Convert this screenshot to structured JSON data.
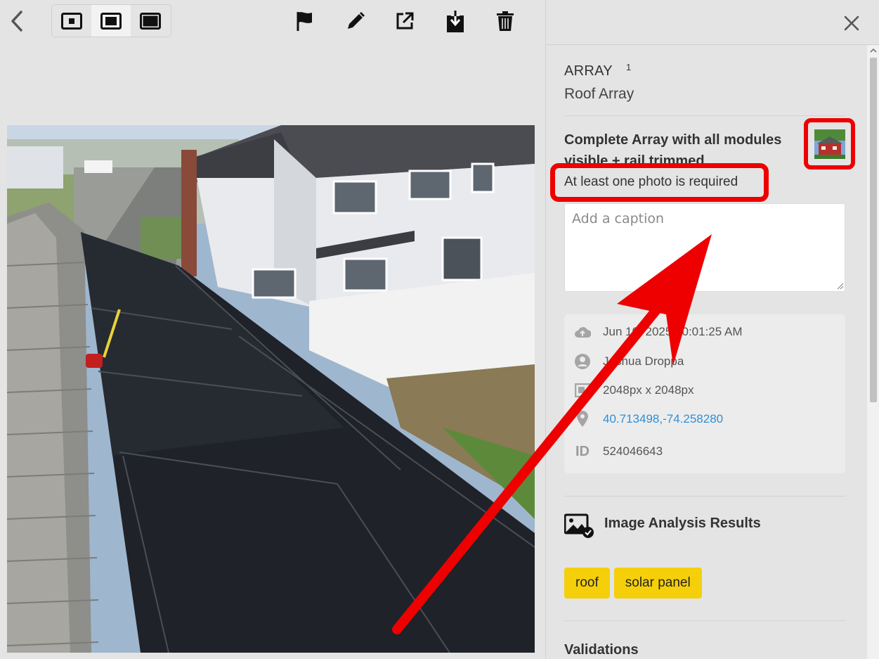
{
  "toolbar": {
    "back_icon": "chevron-left-icon",
    "size_options": [
      "small",
      "medium",
      "large"
    ],
    "active_size": "medium",
    "tools": [
      "flag-icon",
      "pencil-icon",
      "external-link-icon",
      "download-icon",
      "trash-icon"
    ]
  },
  "panel": {
    "section_label": "ARRAY",
    "section_count": "1",
    "section_title": "Roof Array",
    "requirement_title": "Complete Array with all modules visible + rail trimmed",
    "requirement_warning": "At least one photo is required",
    "caption_placeholder": "Add a caption",
    "meta": {
      "uploaded": "Jun 10, 2025 10:01:25 AM",
      "user": "Joshua Droppa",
      "dimensions": "2048px x 2048px",
      "coordinates": "40.713498,-74.258280",
      "id_label": "ID",
      "id": "524046643"
    },
    "analysis_title": "Image Analysis Results",
    "tags": [
      "roof",
      "solar panel"
    ],
    "validations_title": "Validations"
  },
  "colors": {
    "highlight": "#ee0000",
    "tag": "#f5cf0a",
    "link": "#2e8fd8"
  }
}
